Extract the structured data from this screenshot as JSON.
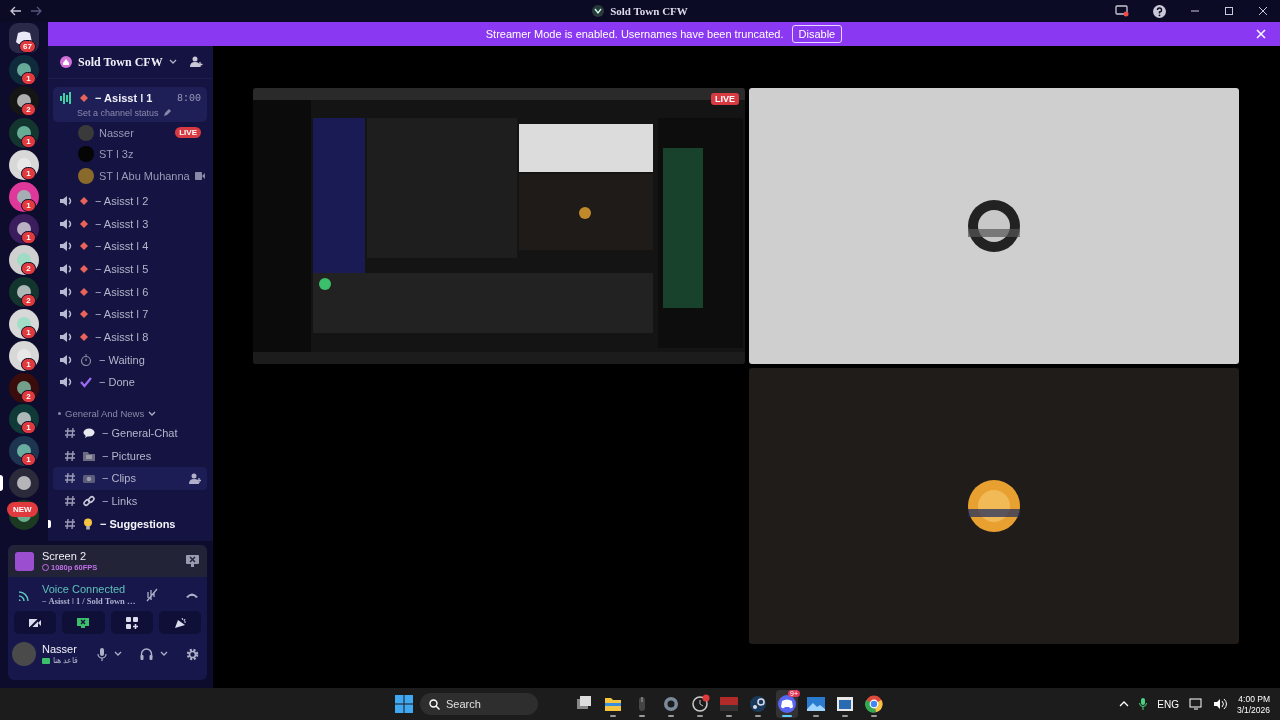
{
  "window": {
    "title": "Sold Town CFW"
  },
  "banner": {
    "message": "Streamer Mode is enabled. Usernames have been truncated.",
    "button": "Disable"
  },
  "servers": [
    {
      "kind": "home",
      "badge": "67",
      "selected": false
    },
    {
      "kind": "server",
      "badge": "1",
      "selected": false
    },
    {
      "kind": "server",
      "badge": "2",
      "selected": false
    },
    {
      "kind": "server",
      "badge": "1",
      "selected": false
    },
    {
      "kind": "server",
      "badge": "1",
      "selected": false
    },
    {
      "kind": "server",
      "badge": "1",
      "selected": false
    },
    {
      "kind": "server",
      "badge": "1",
      "selected": false
    },
    {
      "kind": "server",
      "badge": "2",
      "selected": false
    },
    {
      "kind": "server",
      "badge": "2",
      "selected": false
    },
    {
      "kind": "server",
      "badge": "1",
      "selected": false
    },
    {
      "kind": "server",
      "badge": "1",
      "selected": false
    },
    {
      "kind": "server",
      "badge": "2",
      "selected": false
    },
    {
      "kind": "server",
      "badge": "1",
      "selected": false
    },
    {
      "kind": "server",
      "badge": "1",
      "selected": false
    },
    {
      "kind": "server",
      "selected": true
    },
    {
      "kind": "server",
      "tag": "NEW",
      "selected": false
    }
  ],
  "guild": {
    "name": "Sold Town CFW"
  },
  "voice_channels": [
    {
      "kind": "dot",
      "name": "− Asisst ǀ 1",
      "selected": true,
      "timer": "8:00",
      "status": "Set a channel status",
      "members": [
        {
          "name": "Nasser",
          "badge": "LIVE",
          "video": false
        },
        {
          "name": "ST ǀ 3z",
          "video": false
        },
        {
          "name": "ST ǀ Abu Muhanna",
          "video": true
        }
      ]
    },
    {
      "kind": "dot",
      "name": "− Asisst ǀ 2",
      "selected": false
    },
    {
      "kind": "dot",
      "name": "− Asisst ǀ 3",
      "selected": false
    },
    {
      "kind": "dot",
      "name": "− Asisst ǀ 4",
      "selected": false
    },
    {
      "kind": "dot",
      "name": "− Asisst ǀ 5",
      "selected": false
    },
    {
      "kind": "dot",
      "name": "− Asisst ǀ 6",
      "selected": false
    },
    {
      "kind": "dot",
      "name": "− Asisst ǀ 7",
      "selected": false
    },
    {
      "kind": "dot",
      "name": "− Asisst ǀ 8",
      "selected": false
    },
    {
      "kind": "timer",
      "name": "− Waiting",
      "selected": false
    },
    {
      "kind": "check",
      "name": "− Done",
      "selected": false
    }
  ],
  "category": {
    "name": "General And News",
    "expanded": true
  },
  "text_channels": [
    {
      "kind": "speech",
      "name": "− General-Chat",
      "unread": false,
      "hovered": false
    },
    {
      "kind": "folder",
      "name": "− Pictures",
      "unread": false,
      "hovered": false
    },
    {
      "kind": "camera",
      "name": "− Clips",
      "unread": false,
      "hovered": true
    },
    {
      "kind": "link",
      "name": "− Links",
      "unread": false,
      "hovered": false
    },
    {
      "kind": "bulb",
      "name": "− Suggestions",
      "unread": true,
      "hovered": false
    }
  ],
  "stream": {
    "title": "Screen 2",
    "quality": "1080p 60FPS"
  },
  "voice": {
    "status": "Voice Connected",
    "location": "− Asisst ǀ 1 / Sold Town …"
  },
  "user": {
    "name": "Nasser",
    "status": "قاعد هنا"
  },
  "stage": {
    "tiles": [
      {
        "kind": "screen",
        "badge": "LIVE"
      },
      {
        "kind": "avatar",
        "color": "#cfcfcf"
      },
      {
        "kind": "empty"
      },
      {
        "kind": "avatar",
        "color": "#1f1c1a"
      }
    ]
  },
  "taskbar": {
    "placeholder": "Search",
    "apps": [
      {
        "kind": "taskview",
        "open": false,
        "selected": false
      },
      {
        "kind": "folder",
        "open": true,
        "selected": false
      },
      {
        "kind": "mouse",
        "open": true,
        "selected": false
      },
      {
        "kind": "gear",
        "open": true,
        "selected": false
      },
      {
        "kind": "clock",
        "open": true,
        "selected": false
      },
      {
        "kind": "mixer",
        "open": true,
        "selected": false
      },
      {
        "kind": "steam",
        "open": true,
        "selected": false
      },
      {
        "kind": "discord",
        "open": true,
        "selected": true,
        "badge": "9+"
      },
      {
        "kind": "photos",
        "open": true,
        "selected": false
      },
      {
        "kind": "window",
        "open": true,
        "selected": false
      },
      {
        "kind": "browser",
        "open": true,
        "selected": false
      }
    ],
    "tray": {
      "language": "ENG",
      "time": "4:00 PM",
      "date": "3/1/2026"
    }
  }
}
